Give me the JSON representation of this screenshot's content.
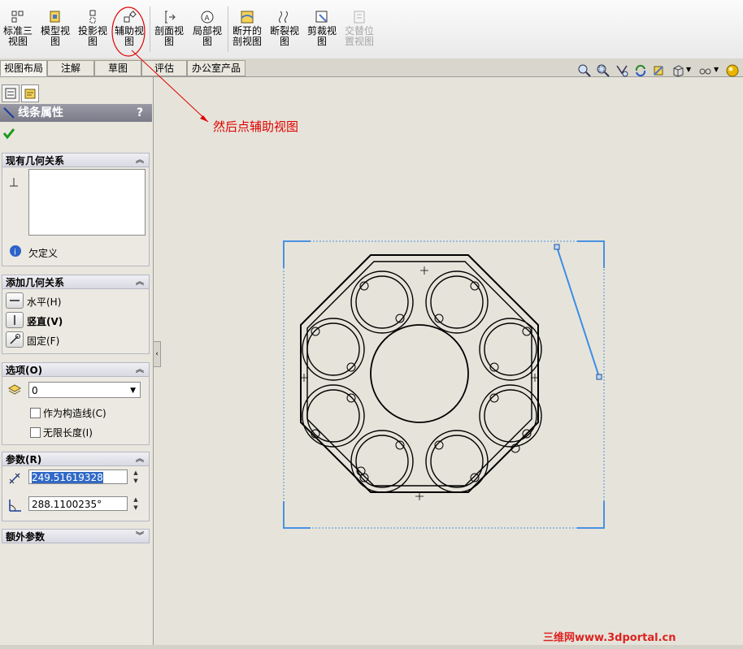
{
  "toolbar": {
    "buttons": [
      {
        "label": "标准三\n视图",
        "icon": "standard-3-view-icon"
      },
      {
        "label": "模型视\n图",
        "icon": "model-view-icon"
      },
      {
        "label": "投影视\n图",
        "icon": "projected-view-icon"
      },
      {
        "label": "辅助视\n图",
        "icon": "auxiliary-view-icon"
      },
      {
        "label": "剖面视\n图",
        "icon": "section-view-icon"
      },
      {
        "label": "局部视\n图",
        "icon": "detail-view-icon"
      },
      {
        "label": "断开的\n剖视图",
        "icon": "broken-out-section-icon"
      },
      {
        "label": "断裂视\n图",
        "icon": "break-view-icon"
      },
      {
        "label": "剪裁视\n图",
        "icon": "crop-view-icon"
      },
      {
        "label": "交替位\n置视图",
        "icon": "alternate-position-view-icon"
      }
    ]
  },
  "tabs": [
    "视图布局",
    "注解",
    "草图",
    "评估",
    "办公室产品"
  ],
  "property_manager": {
    "title": "线条属性",
    "help": "?",
    "existing_relations": {
      "header": "现有几何关系",
      "status": "欠定义"
    },
    "add_relations": {
      "header": "添加几何关系",
      "items": [
        "水平(H)",
        "竖直(V)",
        "固定(F)"
      ]
    },
    "options": {
      "header": "选项(O)",
      "layer_value": "0",
      "construction": "作为构造线(C)",
      "infinite": "无限长度(I)"
    },
    "parameters": {
      "header": "参数(R)",
      "length": "249.51619328",
      "angle": "288.1100235°"
    },
    "extra": {
      "header": "额外参数"
    }
  },
  "annotation": {
    "text": "然后点辅助视图",
    "color": "#e00000"
  },
  "watermark": "三维网www.3dportal.cn",
  "colors": {
    "accent_blue": "#3c8ce6",
    "red": "#e00000",
    "header": "#7a7a88"
  }
}
